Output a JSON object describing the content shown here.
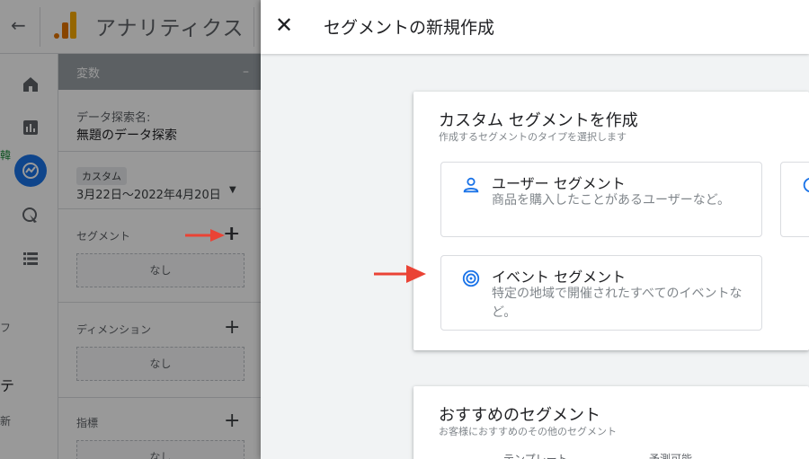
{
  "app": {
    "title": "アナリティクス",
    "back_icon": "arrow-left-icon"
  },
  "rail": {
    "items": [
      "home-icon",
      "reports-icon",
      "explore-icon",
      "advertising-icon",
      "configure-icon"
    ],
    "active": "explore-icon"
  },
  "panel": {
    "header": "変数",
    "collapse_label": "–",
    "name_label": "データ探索名:",
    "name_value": "無題のデータ探索",
    "date_chip": "カスタム",
    "date_range": "3月22日～2022年4月20日",
    "segment_label": "セグメント",
    "segment_none": "なし",
    "dimension_label": "ディメンション",
    "dimension_none": "なし",
    "metric_label": "指標",
    "metric_none": "なし",
    "edge_marks": [
      "韓",
      "フ",
      "テ",
      "新"
    ]
  },
  "drawer": {
    "title": "セグメントの新規作成",
    "close_icon": "close-icon",
    "custom_card": {
      "title": "カスタム セグメントを作成",
      "subtitle": "作成するセグメントのタイプを選択します",
      "options": [
        {
          "title": "ユーザー セグメント",
          "desc": "商品を購入したことがあるユーザーなど。",
          "icon": "person-icon"
        },
        {
          "title": "イベント セグメント",
          "desc": "特定の地域で開催されたすべてのイベントなど。",
          "icon": "event-icon"
        }
      ]
    },
    "recommended_card": {
      "title": "おすすめのセグメント",
      "subtitle": "お客様におすすめのその他のセグメント",
      "partial": [
        "テンプレート",
        "予測可能"
      ]
    }
  },
  "colors": {
    "accent": "#1a73e8",
    "annotation_arrow": "#ea4335",
    "ga_orange": "#f9ab00"
  }
}
